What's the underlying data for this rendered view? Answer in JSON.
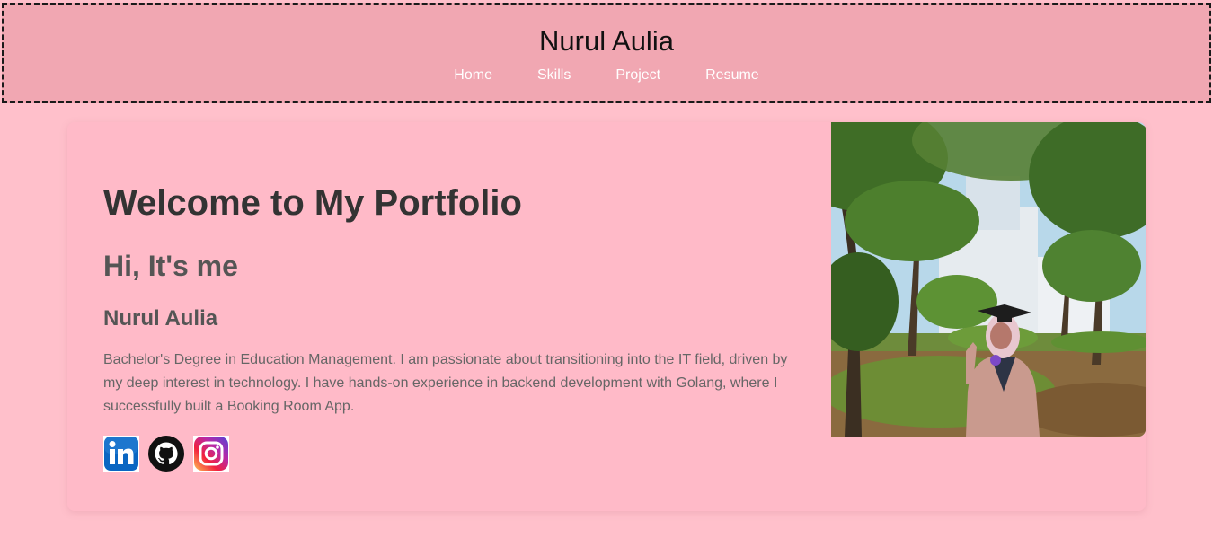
{
  "header": {
    "title": "Nurul Aulia",
    "nav": [
      {
        "label": "Home"
      },
      {
        "label": "Skills"
      },
      {
        "label": "Project"
      },
      {
        "label": "Resume"
      }
    ]
  },
  "hero": {
    "heading": "Welcome to My Portfolio",
    "greeting": "Hi, It's me",
    "name": "Nurul Aulia",
    "bio": "Bachelor's Degree in Education Management. I am passionate about transitioning into the IT field, driven by my deep interest in technology. I have hands-on experience in backend development with Golang, where I successfully built a Booking Room App.",
    "socials": [
      {
        "icon": "linkedin-icon"
      },
      {
        "icon": "github-icon"
      },
      {
        "icon": "instagram-icon"
      }
    ],
    "photo": {
      "subject": "graduation-portrait-photo"
    }
  },
  "colors": {
    "page_bg": "#ffc0cb",
    "header_bg": "#f1a7b2",
    "card_bg": "#ffbac8",
    "heading": "#333333",
    "subheading": "#555555",
    "body_text": "#666666",
    "nav_text": "#ffffff"
  }
}
